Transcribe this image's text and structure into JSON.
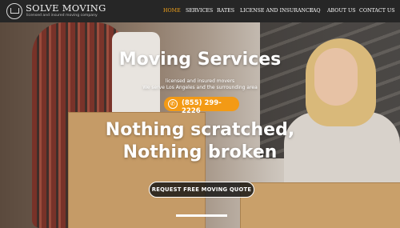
{
  "brand": {
    "name": "SOLVE MOVING",
    "tagline": "licensed and insured moving company"
  },
  "nav": {
    "items": [
      {
        "label": "HOME",
        "active": true
      },
      {
        "label": "SERVICES",
        "active": false
      },
      {
        "label": "RATES",
        "active": false
      },
      {
        "label": "LICENSE AND INSURANCE",
        "active": false
      },
      {
        "label": "FAQ",
        "active": false
      },
      {
        "label": "ABOUT US",
        "active": false
      },
      {
        "label": "CONTACT US",
        "active": false
      }
    ]
  },
  "hero": {
    "title": "Moving Services",
    "subtitle_line1": "licensed and insured movers",
    "subtitle_line2": "We serve Los Angeles and the surrounding area",
    "phone": "(855) 299-2226",
    "tagline_line1": "Nothing scratched,",
    "tagline_line2": "Nothing broken",
    "cta_label": "REQUEST FREE MOVING QUOTE"
  },
  "colors": {
    "navbar": "#262626",
    "accent": "#f39a15",
    "nav_active": "#f0a11b"
  },
  "icons": {
    "logo": "truck-circle-logo",
    "phone": "phone-icon"
  }
}
